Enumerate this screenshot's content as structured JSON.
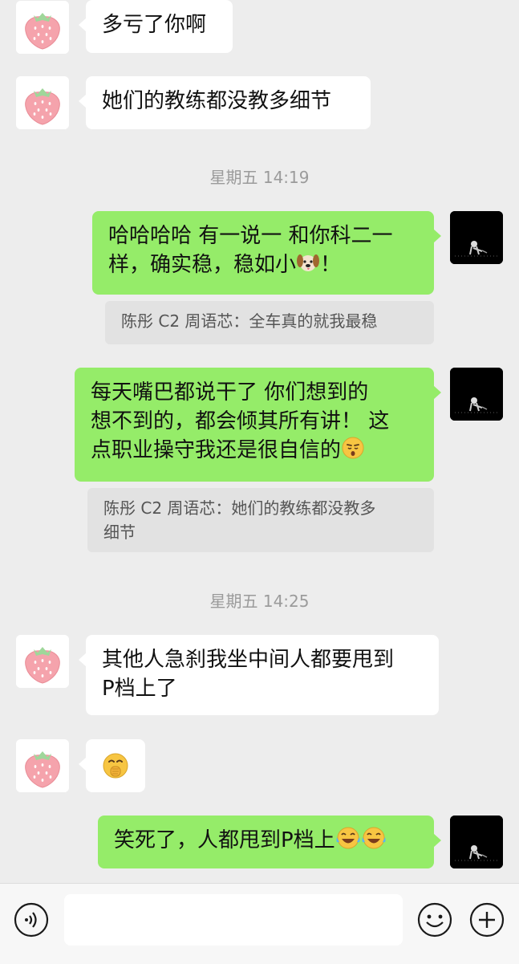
{
  "messages": [
    {
      "side": "left",
      "text": "多亏了你啊"
    },
    {
      "side": "left",
      "text": "她们的教练都没教多细节"
    },
    {
      "time": "星期五 14:19"
    },
    {
      "side": "right",
      "text": "哈哈哈哈 有一说一 和你科二一样，确实稳，稳如小",
      "emoji": "dog-face",
      "tail": "！",
      "quote": "陈彤 C2 周语芯：全车真的就我最稳"
    },
    {
      "side": "right",
      "text": "每天嘴巴都说干了 你们想到的想不到的，都会倾其所有讲！ 这点职业操守我还是很自信的",
      "emoji": "kissing-face",
      "quote": "陈彤 C2 周语芯：她们的教练都没教多细节"
    },
    {
      "time": "星期五 14:25"
    },
    {
      "side": "left",
      "text": "其他人急刹我坐中间人都要甩到P档上了"
    },
    {
      "side": "left",
      "emoji": "hand-over-mouth-face"
    },
    {
      "side": "right",
      "text": "笑死了，人都甩到P档上",
      "emoji": "crying-laughing-face x2"
    }
  ],
  "strings": {
    "m1": "多亏了你啊",
    "m2": "她们的教练都没教多细节",
    "t1": "星期五 14:19",
    "m3a": "哈哈哈哈 有一说一 和你科二一",
    "m3b": "样，确实稳，稳如小",
    "m3c": "！",
    "q1": "陈彤 C2 周语芯：全车真的就我最稳",
    "m4a": "每天嘴巴都说干了 你们想到的",
    "m4b": "想不到的，都会倾其所有讲！ 这",
    "m4c": "点职业操守我还是很自信的",
    "q2a": "陈彤 C2 周语芯：她们的教练都没教多",
    "q2b": "细节",
    "t2": "星期五 14:25",
    "m5a": "其他人急刹我坐中间人都要甩到",
    "m5b": "P档上了",
    "m7": "笑死了，人都甩到P档上"
  },
  "avatars": {
    "left": "strawberry-avatar",
    "right": "dark-photo-avatar"
  },
  "colors": {
    "background": "#ededed",
    "self_bubble": "#95ec69",
    "other_bubble": "#ffffff",
    "quote_bg": "#e2e2e2"
  },
  "input": {
    "value": "",
    "icons": [
      "voice-icon",
      "emoji-icon",
      "plus-icon"
    ]
  }
}
